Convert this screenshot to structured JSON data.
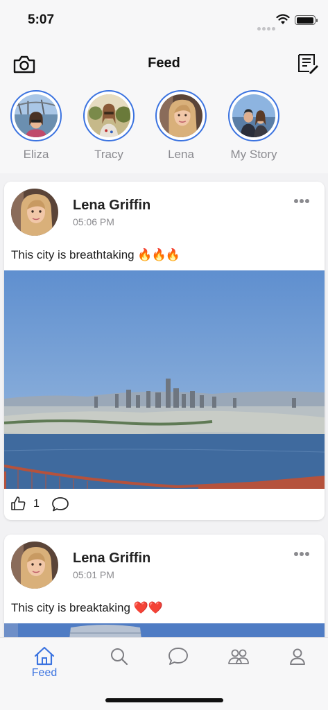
{
  "status_bar": {
    "time": "5:07"
  },
  "nav": {
    "title": "Feed",
    "left_icon": "camera-icon",
    "right_icon": "compose-icon"
  },
  "stories": [
    {
      "name": "Eliza"
    },
    {
      "name": "Tracy"
    },
    {
      "name": "Lena"
    },
    {
      "name": "My Story"
    }
  ],
  "posts": [
    {
      "author": "Lena Griffin",
      "time": "05:06 PM",
      "text": "This city is breathtaking",
      "emoji": "🔥🔥🔥",
      "likes": "1"
    },
    {
      "author": "Lena Griffin",
      "time": "05:01 PM",
      "text": "This city is breaktaking",
      "emoji": "❤️❤️"
    }
  ],
  "tabs": [
    {
      "label": "Feed",
      "icon": "home-icon",
      "active": true
    },
    {
      "label": "",
      "icon": "search-icon"
    },
    {
      "label": "",
      "icon": "chat-icon"
    },
    {
      "label": "",
      "icon": "friends-icon"
    },
    {
      "label": "",
      "icon": "profile-icon"
    }
  ],
  "colors": {
    "accent": "#3b73e0",
    "background": "#f2f2f4"
  }
}
